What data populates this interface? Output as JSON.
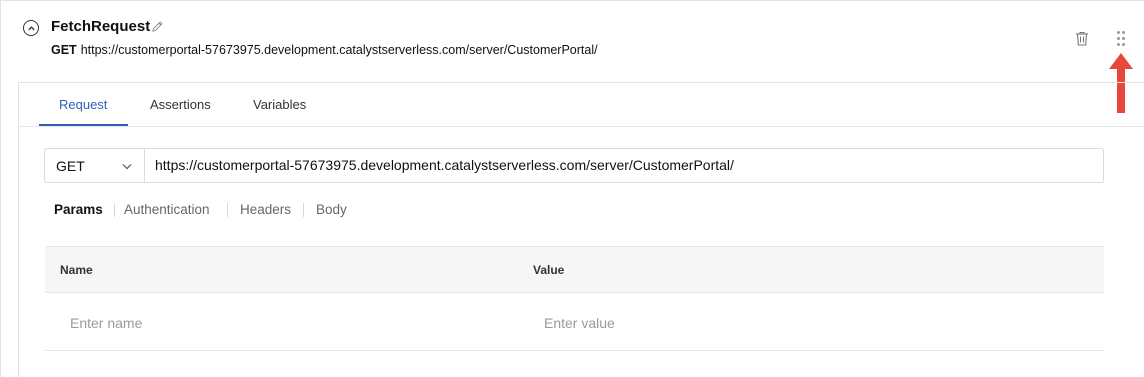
{
  "step": {
    "name": "FetchRequest",
    "method": "GET",
    "url": "https://customerportal-57673975.development.catalystserverless.com/server/CustomerPortal/"
  },
  "icons": {
    "collapse": "chevron-up-circle-icon",
    "edit": "pencil-icon",
    "delete": "trash-icon",
    "drag": "drag-handle-icon",
    "annotation": "red-arrow-icon"
  },
  "tabs": [
    {
      "label": "Request",
      "active": true
    },
    {
      "label": "Assertions",
      "active": false
    },
    {
      "label": "Variables",
      "active": false
    }
  ],
  "request": {
    "method": "GET",
    "url": "https://customerportal-57673975.development.catalystserverless.com/server/CustomerPortal/"
  },
  "subtabs": [
    {
      "label": "Params",
      "active": true
    },
    {
      "label": "Authentication",
      "active": false
    },
    {
      "label": "Headers",
      "active": false
    },
    {
      "label": "Body",
      "active": false
    }
  ],
  "params_table": {
    "columns": [
      "Name",
      "Value"
    ],
    "rows": [
      {
        "name_placeholder": "Enter name",
        "value_placeholder": "Enter value"
      }
    ]
  },
  "colors": {
    "accent": "#2f62b8",
    "annotation_arrow": "#e8473b"
  }
}
